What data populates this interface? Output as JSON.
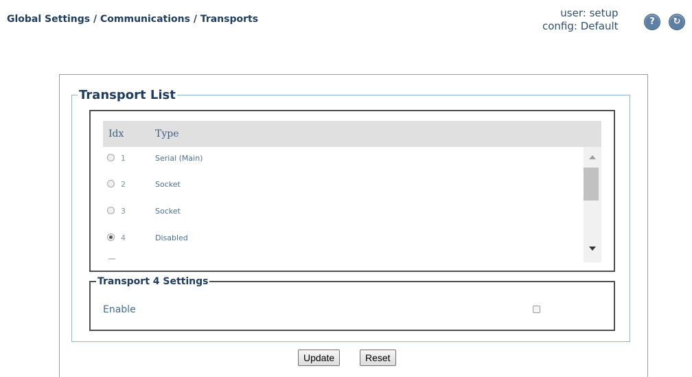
{
  "header": {
    "breadcrumb": "Global Settings / Communications / Transports",
    "user_line": "user: setup",
    "config_line": "config: Default",
    "help_icon_glyph": "?",
    "info_icon_glyph": "↻"
  },
  "transport_list": {
    "legend": "Transport List",
    "columns": {
      "idx": "Idx",
      "type": "Type"
    },
    "rows": [
      {
        "idx": "1",
        "type": "Serial (Main)",
        "selected": false
      },
      {
        "idx": "2",
        "type": "Socket",
        "selected": false
      },
      {
        "idx": "3",
        "type": "Socket",
        "selected": false
      },
      {
        "idx": "4",
        "type": "Disabled",
        "selected": true
      }
    ]
  },
  "settings": {
    "legend": "Transport 4 Settings",
    "enable_label": "Enable",
    "enable_checked": false
  },
  "buttons": {
    "update": "Update",
    "reset": "Reset"
  },
  "icons": {
    "help": "help-icon",
    "refresh": "refresh-icon"
  }
}
